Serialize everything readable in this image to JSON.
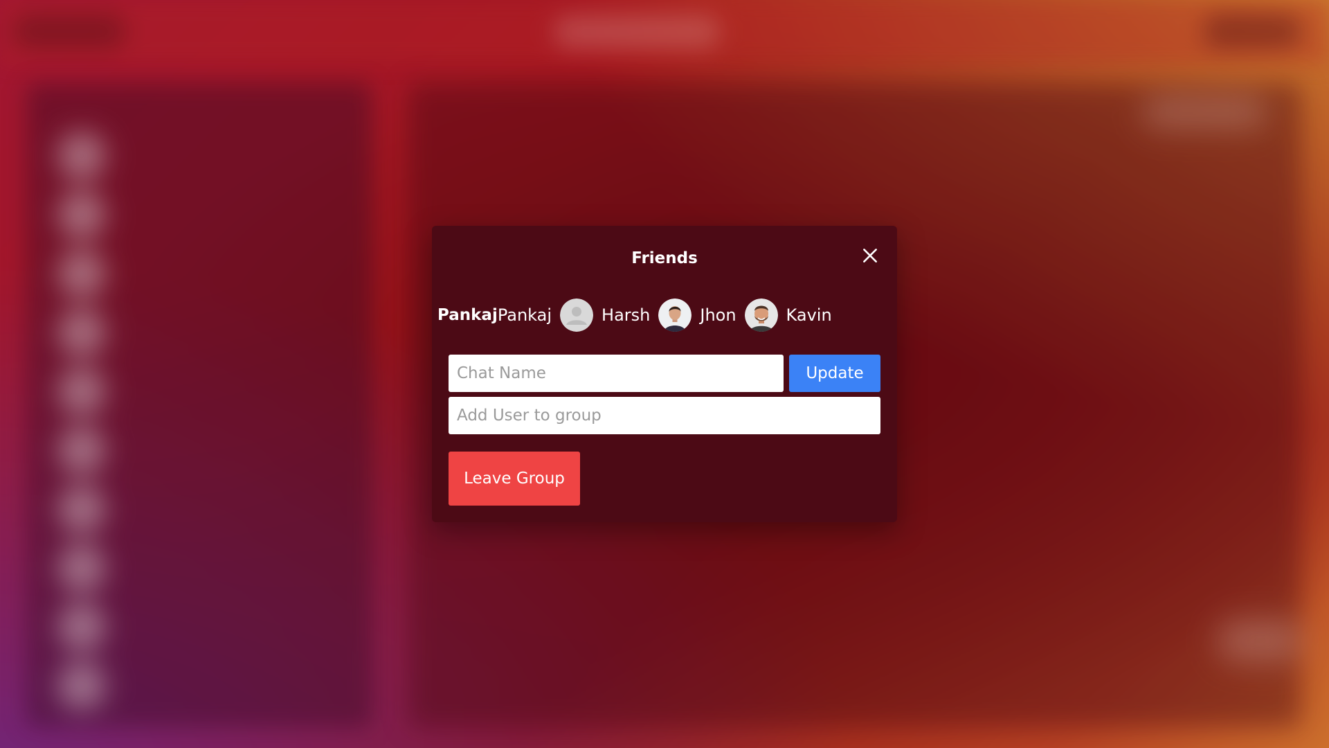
{
  "modal": {
    "title": "Friends",
    "close_icon": "close-icon"
  },
  "members": {
    "current_user": "Pankaj",
    "list": [
      {
        "name": "Pankaj",
        "avatar": "default-avatar-icon"
      },
      {
        "name": "Harsh",
        "avatar": "user-photo"
      },
      {
        "name": "Jhon",
        "avatar": "user-photo"
      },
      {
        "name": "Kavin",
        "avatar": ""
      }
    ]
  },
  "form": {
    "chat_name_placeholder": "Chat Name",
    "chat_name_value": "",
    "add_user_placeholder": "Add User to group",
    "add_user_value": "",
    "update_label": "Update",
    "leave_label": "Leave Group"
  },
  "colors": {
    "modal_bg": "#4c0a15",
    "update_button": "#3b82f6",
    "leave_button": "#ef4444"
  }
}
